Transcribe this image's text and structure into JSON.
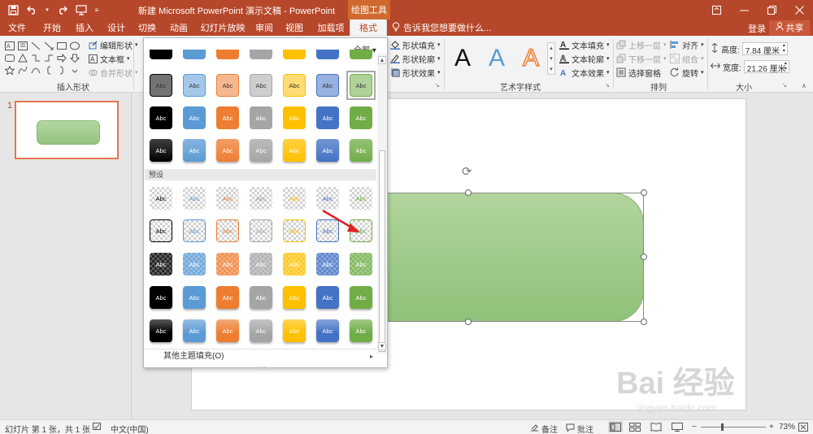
{
  "titlebar": {
    "title": "新建 Microsoft PowerPoint 演示文稿 - PowerPoint",
    "context_tab": "绘图工具",
    "save_icon": "save-icon",
    "undo_icon": "undo-icon",
    "redo_icon": "redo-icon"
  },
  "tabs": [
    {
      "label": "文件"
    },
    {
      "label": "开始"
    },
    {
      "label": "插入"
    },
    {
      "label": "设计"
    },
    {
      "label": "切换"
    },
    {
      "label": "动画"
    },
    {
      "label": "幻灯片放映"
    },
    {
      "label": "审阅"
    },
    {
      "label": "视图"
    },
    {
      "label": "加载项"
    },
    {
      "label": "格式"
    }
  ],
  "tell_me": "告诉我您想要做什么...",
  "login": "登录",
  "share": "共享",
  "ribbon": {
    "insert_shapes": {
      "label": "插入形状",
      "edit_shape": "编辑形状",
      "text_box": "文本框",
      "merge_shapes": "合并形状"
    },
    "shape_styles": {
      "fill": "形状填充",
      "outline": "形状轮廓",
      "effects": "形状效果"
    },
    "wordart": {
      "label": "艺术字样式",
      "text_fill": "文本填充",
      "text_outline": "文本轮廓",
      "text_effects": "文本效果"
    },
    "arrange": {
      "label": "排列",
      "bring_forward": "上移一层",
      "send_backward": "下移一层",
      "selection_pane": "选择窗格",
      "align": "对齐",
      "group": "组合",
      "rotate": "旋转"
    },
    "size": {
      "label": "大小",
      "height_label": "高度:",
      "height_value": "7.84 厘米",
      "width_label": "宽度:",
      "width_value": "21.26 厘米"
    }
  },
  "gallery": {
    "filter": "全部",
    "sample_text": "Abc",
    "preset_header": "预设",
    "more_fills": "其他主题填充(O)",
    "theme_colors": [
      "#000000",
      "#5b9bd5",
      "#ed7d31",
      "#a5a5a5",
      "#ffc000",
      "#4472c4",
      "#70ad47"
    ],
    "selected_style": "moderate-effect-green"
  },
  "thumbnail": {
    "number": "1"
  },
  "statusbar": {
    "slide_info": "幻灯片 第 1 张，共 1 张",
    "language": "中文(中国)",
    "notes": "备注",
    "comments": "批注",
    "zoom": "73%"
  },
  "watermark": {
    "main": "Bai  经验",
    "sub": "jingyan.baidu.com"
  }
}
